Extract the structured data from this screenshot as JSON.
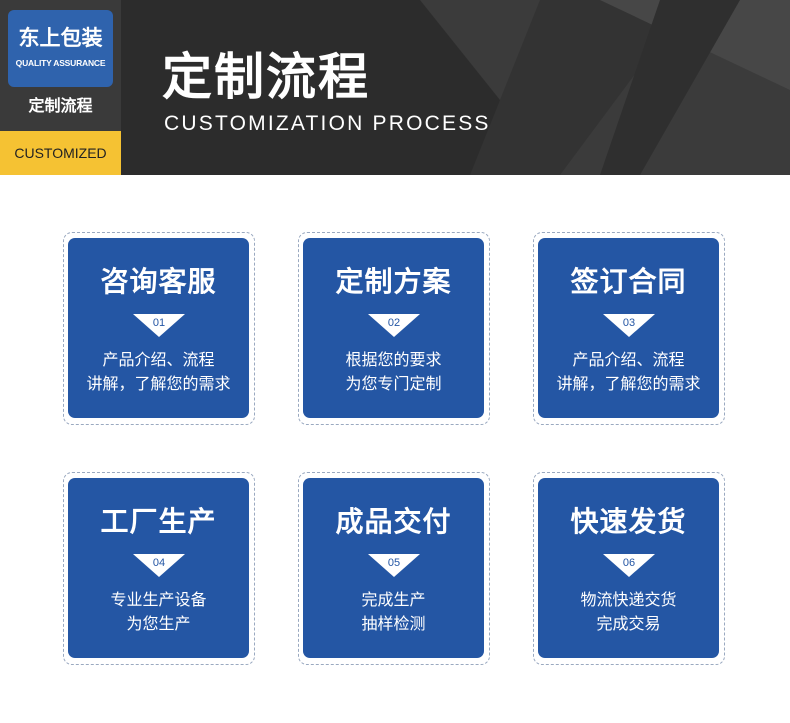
{
  "brand": {
    "name": "东上包装",
    "tagline": "QUALITY ASSURANCE",
    "caption": "定制流程",
    "tag": "CUSTOMIZED"
  },
  "header": {
    "title": "定制流程",
    "subtitle": "CUSTOMIZATION PROCESS"
  },
  "colors": {
    "card": "#2456a4",
    "logo": "#2f63ad",
    "accent": "#f5c233",
    "header_bg": "#2b2b2b"
  },
  "steps": [
    {
      "title": "咨询客服",
      "number": "01",
      "lines": [
        "产品介绍、流程",
        "讲解，了解您的需求"
      ]
    },
    {
      "title": "定制方案",
      "number": "02",
      "lines": [
        "根据您的要求",
        "为您专门定制"
      ]
    },
    {
      "title": "签订合同",
      "number": "03",
      "lines": [
        "产品介绍、流程",
        "讲解，了解您的需求"
      ]
    },
    {
      "title": "工厂生产",
      "number": "04",
      "lines": [
        "专业生产设备",
        "为您生产"
      ]
    },
    {
      "title": "成品交付",
      "number": "05",
      "lines": [
        "完成生产",
        "抽样检测"
      ]
    },
    {
      "title": "快速发货",
      "number": "06",
      "lines": [
        "物流快递交货",
        "完成交易"
      ]
    }
  ]
}
